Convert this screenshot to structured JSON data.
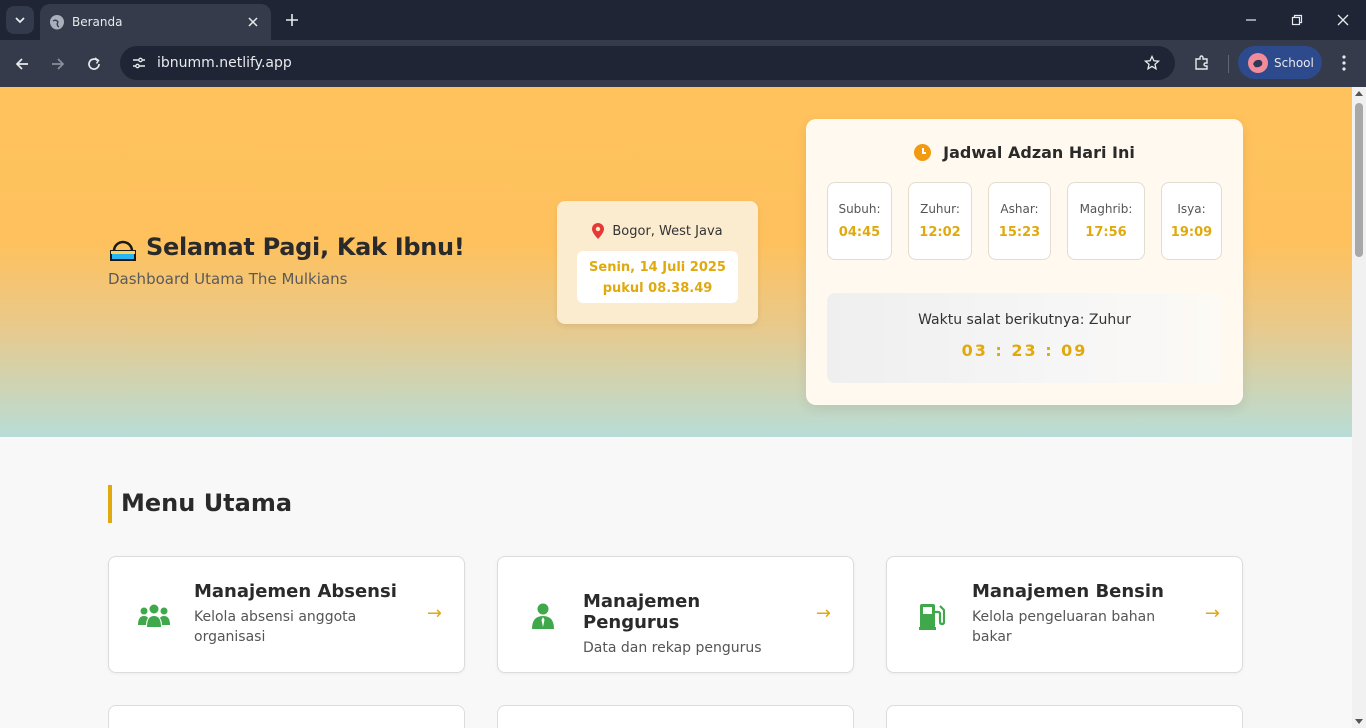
{
  "browser": {
    "tab_title": "Beranda",
    "url": "ibnumm.netlify.app",
    "profile_label": "School"
  },
  "hero": {
    "greeting": "Selamat Pagi, Kak Ibnu!",
    "subtitle": "Dashboard Utama The Mulkians",
    "location": "Bogor, West Java",
    "date_line1": "Senin, 14 Juli 2025",
    "date_line2": "pukul 08.38.49"
  },
  "adzan": {
    "title": "Jadwal Adzan Hari Ini",
    "prayers": [
      {
        "name": "Subuh:",
        "time": "04:45"
      },
      {
        "name": "Zuhur:",
        "time": "12:02"
      },
      {
        "name": "Ashar:",
        "time": "15:23"
      },
      {
        "name": "Maghrib:",
        "time": "17:56"
      },
      {
        "name": "Isya:",
        "time": "19:09"
      }
    ],
    "next_label": "Waktu salat berikutnya: Zuhur",
    "countdown": "03 : 23 : 09"
  },
  "menu": {
    "section_title": "Menu Utama",
    "arrow": "→",
    "items": [
      {
        "title": "Manajemen Absensi",
        "desc": "Kelola absensi anggota organisasi",
        "icon": "users-icon"
      },
      {
        "title": "Manajemen Pengurus",
        "desc": "Data dan rekap pengurus",
        "icon": "person-tie-icon"
      },
      {
        "title": "Manajemen Bensin",
        "desc": "Kelola pengeluaran bahan bakar",
        "icon": "gas-pump-icon"
      }
    ]
  },
  "colors": {
    "accent": "#e0a90e",
    "icon_green": "#3ea84a",
    "hero_top": "#ffc25c",
    "hero_bottom": "#b8ddd7"
  }
}
